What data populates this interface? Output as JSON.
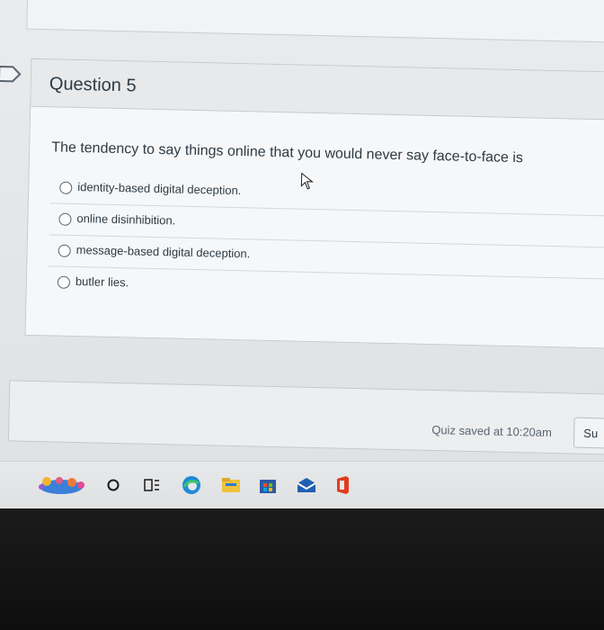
{
  "question": {
    "title": "Question 5",
    "text": "The tendency to say things online that you would never say face-to-face is",
    "answers": [
      "identity-based digital deception.",
      "online disinhibition.",
      "message-based digital deception.",
      "butler lies."
    ]
  },
  "footer": {
    "saved_status": "Quiz saved at 10:20am",
    "submit_label": "Su"
  },
  "taskbar": {
    "icons": [
      "app-icon",
      "search-circle-icon",
      "task-view-icon",
      "edge-browser-icon",
      "file-explorer-icon",
      "store-icon",
      "mail-icon",
      "office-icon"
    ]
  },
  "colors": {
    "text": "#2d3b45",
    "panel": "#f4f5f6",
    "header": "#e7e9eb",
    "border": "#c6c9cc"
  }
}
